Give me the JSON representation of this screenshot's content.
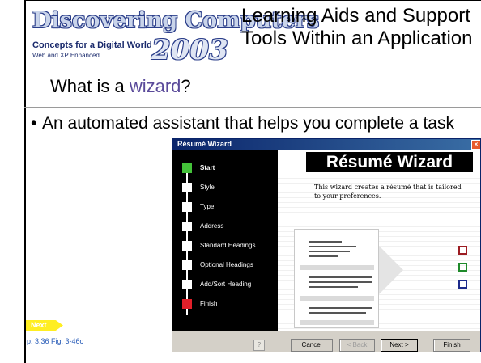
{
  "logo": {
    "title": "Discovering Computers",
    "subtitle": "Concepts for a Digital World",
    "edition": "Web and XP Enhanced",
    "year": "2003"
  },
  "heading": "Learning Aids and Support Tools Within an Application",
  "question": {
    "prefix": "What is a ",
    "highlight": "wizard",
    "suffix": "?"
  },
  "bullet": {
    "marker": "•",
    "text": "An automated assistant that helps you complete a task"
  },
  "nav": {
    "next_label": "Next",
    "page_ref": "p. 3.36 Fig. 3-46c"
  },
  "wizard": {
    "window_title": "Résumé Wizard",
    "close_glyph": "×",
    "main_title": "Résumé Wizard",
    "description": "This wizard creates a résumé that is tailored to your preferences.",
    "steps": [
      {
        "label": "Start"
      },
      {
        "label": "Style"
      },
      {
        "label": "Type"
      },
      {
        "label": "Address"
      },
      {
        "label": "Standard Headings"
      },
      {
        "label": "Optional Headings"
      },
      {
        "label": "Add/Sort Heading"
      },
      {
        "label": "Finish"
      }
    ],
    "buttons": {
      "help": "?",
      "cancel": "Cancel",
      "back": "< Back",
      "next": "Next >",
      "finish": "Finish"
    },
    "colors": {
      "start_step": "#44c23a",
      "finish_step": "#e2202a",
      "square_red": "#9c1c22",
      "square_green": "#1f8a2a",
      "square_blue": "#1c2a8a"
    }
  }
}
